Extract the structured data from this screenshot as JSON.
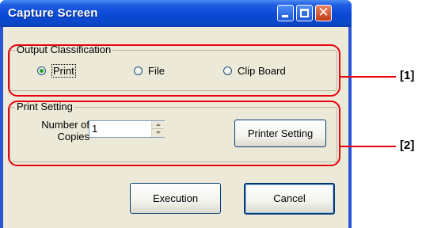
{
  "window": {
    "title": "Capture Screen",
    "controls": {
      "minimize": "minimize-icon",
      "maximize": "maximize-icon",
      "close": "close-icon"
    },
    "close_glyph": "✕"
  },
  "output_classification": {
    "legend": "Output Classification",
    "options": [
      {
        "label": "Print",
        "selected": true
      },
      {
        "label": "File",
        "selected": false
      },
      {
        "label": "Clip Board",
        "selected": false
      }
    ]
  },
  "print_setting": {
    "legend": "Print Setting",
    "copies_label_line1": "Number of",
    "copies_label_line2": "Copies",
    "copies_value": "1",
    "printer_setting_button": "Printer Setting"
  },
  "actions": {
    "execution": "Execution",
    "cancel": "Cancel"
  },
  "annotations": {
    "label_1": "[1]",
    "label_2": "[2]"
  },
  "colors": {
    "annotation": "#e8000a",
    "titlebar": "#0a49d6",
    "dialog_face": "#ece9d8"
  }
}
